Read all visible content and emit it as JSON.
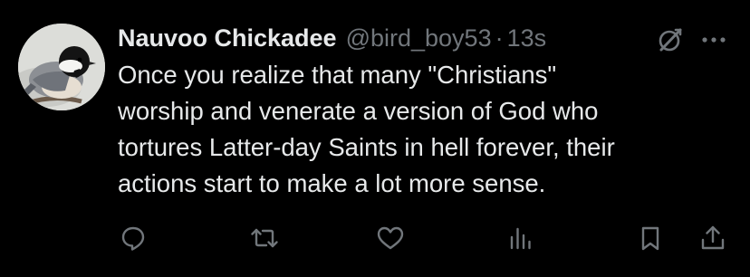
{
  "tweet": {
    "author": {
      "display_name": "Nauvoo Chickadee",
      "handle": "@bird_boy53",
      "avatar_icon": "chickadee-avatar"
    },
    "separator": "·",
    "timestamp": "13s",
    "text": "Once you realize that many \"Christians\"\nworship and venerate a version of God who\ntortures Latter-day Saints in hell forever, their\nactions start to make a lot more sense.",
    "header_icons": [
      "grok-icon",
      "more-icon"
    ],
    "actions": [
      "reply-icon",
      "retweet-icon",
      "like-icon",
      "views-icon",
      "bookmark-icon",
      "share-icon"
    ]
  },
  "colors": {
    "background": "#000000",
    "primary_text": "#e7e9ea",
    "secondary_text": "#71767b"
  }
}
